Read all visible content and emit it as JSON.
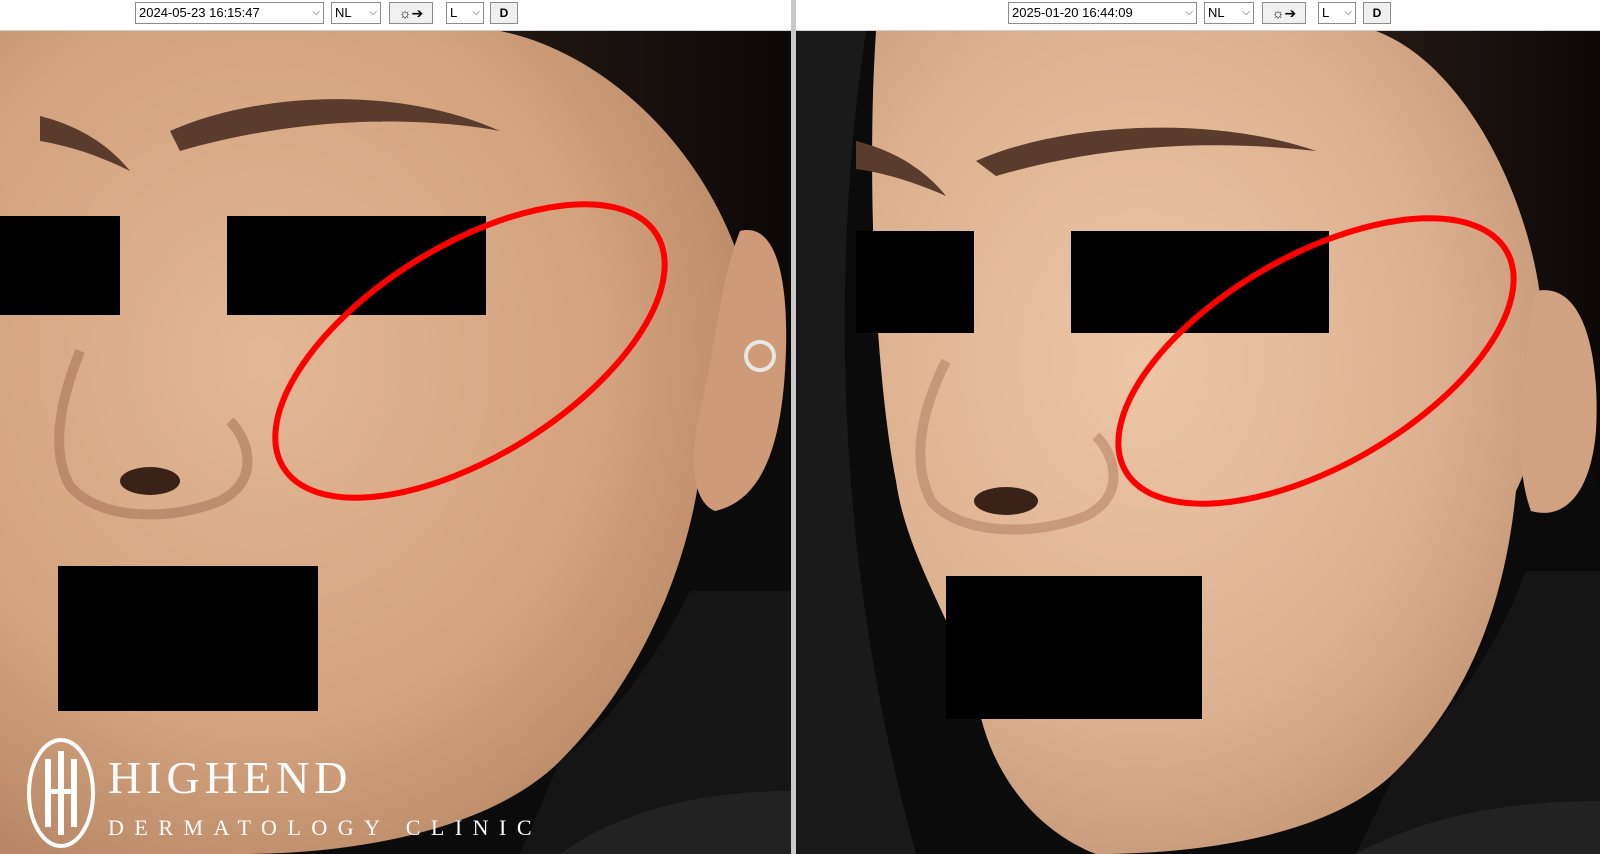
{
  "left_panel": {
    "datetime": "2024-05-23 16:15:47",
    "lighting_mode": "NL",
    "light_icon": "light-bulb-arrow-icon",
    "side": "L",
    "d_button": "D"
  },
  "right_panel": {
    "datetime": "2025-01-20 16:44:09",
    "lighting_mode": "NL",
    "light_icon": "light-bulb-arrow-icon",
    "side": "L",
    "d_button": "D"
  },
  "dropdown_caret": "⌵",
  "light_glyph": "☼➔",
  "logo": {
    "title": "HIGHEND",
    "subtitle": "DERMATOLOGY CLINIC"
  },
  "colors": {
    "annotation_ellipse": "#ff0000",
    "redaction": "#000000",
    "skin": "#d8ab88",
    "background": "#0a0a0a"
  }
}
